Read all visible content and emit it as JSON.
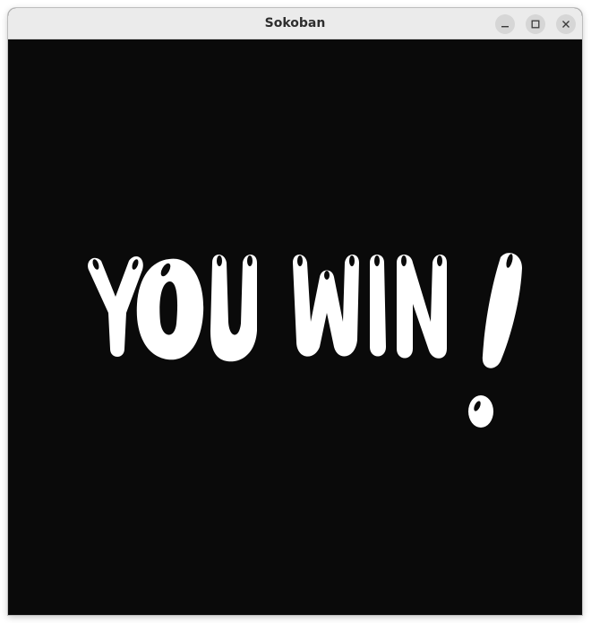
{
  "window": {
    "title": "Sokoban"
  },
  "titlebar": {
    "buttons": [
      {
        "icon": "minimize-icon"
      },
      {
        "icon": "maximize-icon"
      },
      {
        "icon": "close-icon"
      }
    ],
    "background_color": "#ebebeb"
  },
  "game": {
    "background_color": "#0a0a0a",
    "message": "YOU WIN!",
    "message_color": "#ffffff"
  }
}
